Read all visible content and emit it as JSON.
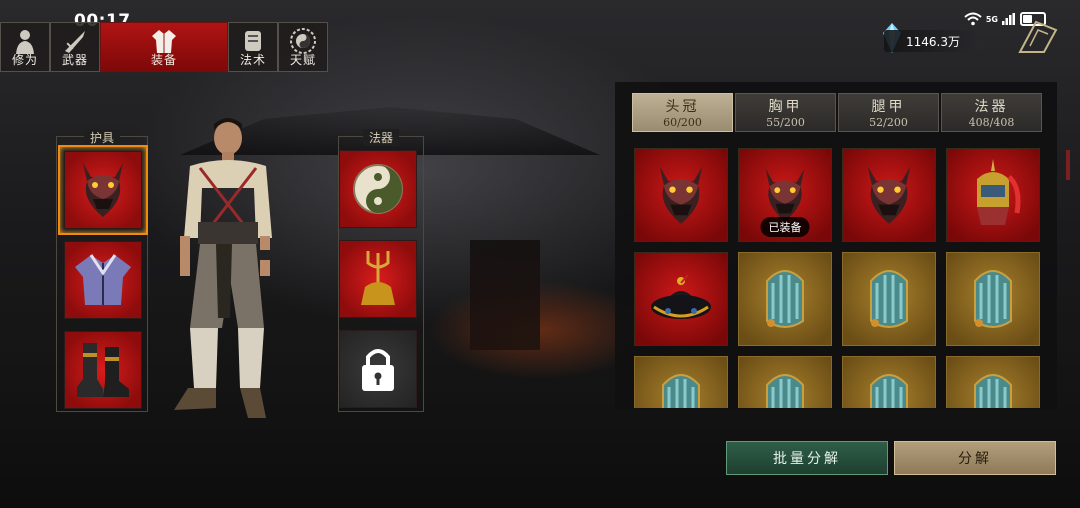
{
  "status": {
    "time": "00:17",
    "network": "5G",
    "wifi_icon": "wifi-icon",
    "signal_icon": "signal-icon",
    "battery_icon": "battery-icon"
  },
  "currency": {
    "amount": "1146.3万",
    "icon": "crystal-icon"
  },
  "top_tabs": [
    {
      "label": "修为",
      "icon": "cultivator-icon",
      "active": false
    },
    {
      "label": "武器",
      "icon": "sword-icon",
      "active": false
    },
    {
      "label": "装备",
      "icon": "robe-icon",
      "active": true
    },
    {
      "label": "法术",
      "icon": "scroll-icon",
      "active": false
    },
    {
      "label": "天赋",
      "icon": "taiji-icon",
      "active": false
    }
  ],
  "left_panel": {
    "armor_title": "护具",
    "magic_title": "法器",
    "armor_slots": [
      {
        "item": "demon-mask-icon",
        "selected": true
      },
      {
        "item": "robe-icon"
      },
      {
        "item": "boots-icon"
      }
    ],
    "magic_slots": [
      {
        "item": "taiji-orb-icon"
      },
      {
        "item": "trident-bell-icon"
      },
      {
        "item": "lock-icon",
        "locked": true
      }
    ]
  },
  "categories": [
    {
      "name": "头冠",
      "count": "60/200",
      "active": true
    },
    {
      "name": "胸甲",
      "count": "55/200",
      "active": false
    },
    {
      "name": "腿甲",
      "count": "52/200",
      "active": false
    },
    {
      "name": "法器",
      "count": "408/408",
      "active": false
    }
  ],
  "inventory": [
    {
      "item": "demon-mask-icon",
      "rarity": "red"
    },
    {
      "item": "demon-mask-icon",
      "rarity": "red",
      "tag": "已装备"
    },
    {
      "item": "demon-mask-icon",
      "rarity": "red"
    },
    {
      "item": "helmet-plume-icon",
      "rarity": "red"
    },
    {
      "item": "official-hat-icon",
      "rarity": "red"
    },
    {
      "item": "jade-headband-icon",
      "rarity": "gold"
    },
    {
      "item": "jade-headband-icon",
      "rarity": "gold"
    },
    {
      "item": "jade-headband-icon",
      "rarity": "gold"
    },
    {
      "item": "jade-headband-icon",
      "rarity": "gold"
    },
    {
      "item": "jade-headband-icon",
      "rarity": "gold"
    },
    {
      "item": "jade-headband-icon",
      "rarity": "gold"
    },
    {
      "item": "jade-headband-icon",
      "rarity": "gold"
    }
  ],
  "buttons": {
    "batch_decompose": "批量分解",
    "decompose": "分解"
  },
  "colors": {
    "active_tab": "#b01414",
    "rarity_red": "#cc1818",
    "rarity_gold": "#a8802c",
    "selection": "#f08a10",
    "batch_btn": "#2f5e48"
  }
}
